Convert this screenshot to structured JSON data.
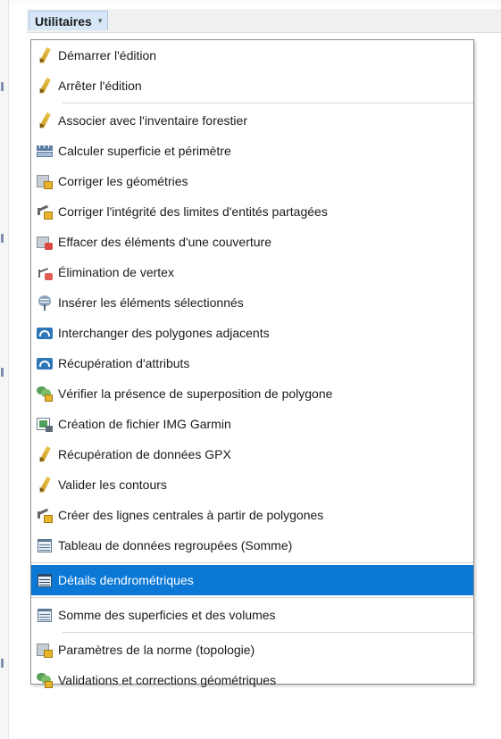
{
  "menu": {
    "title": "Utilitaires",
    "caret": "▾",
    "items": [
      {
        "label": "Démarrer l'édition",
        "icon": "pencil-icon"
      },
      {
        "label": "Arrêter l'édition",
        "icon": "pencil-icon"
      },
      {
        "label": "Associer avec l'inventaire forestier",
        "icon": "pencil-icon"
      },
      {
        "label": "Calculer superficie et périmètre",
        "icon": "ruler-icon"
      },
      {
        "label": "Corriger les géométries",
        "icon": "layer-edit-icon"
      },
      {
        "label": "Corriger l'intégrité des limites d'entités partagées",
        "icon": "line-edit-icon"
      },
      {
        "label": "Effacer des éléments d'une couverture",
        "icon": "erase-layer-icon"
      },
      {
        "label": "Élimination de vertex",
        "icon": "vertex-delete-icon"
      },
      {
        "label": "Insérer les éléments sélectionnés",
        "icon": "tree-icon"
      },
      {
        "label": "Interchanger des polygones adjacents",
        "icon": "swap-polygons-icon"
      },
      {
        "label": "Récupération d'attributs",
        "icon": "swap-polygons-icon"
      },
      {
        "label": "Vérifier la présence de superposition de polygone",
        "icon": "overlap-check-icon"
      },
      {
        "label": "Création de fichier IMG Garmin",
        "icon": "garmin-image-icon"
      },
      {
        "label": "Récupération de données GPX",
        "icon": "pencil-icon"
      },
      {
        "label": "Valider les contours",
        "icon": "pencil-icon"
      },
      {
        "label": "Créer des lignes centrales à partir de polygones",
        "icon": "line-edit-icon"
      },
      {
        "label": "Tableau de données regroupées (Somme)",
        "icon": "table-icon"
      },
      {
        "label": "Détails dendrométriques",
        "icon": "table-icon"
      },
      {
        "label": "Somme des superficies et des volumes",
        "icon": "table-icon"
      },
      {
        "label": "Paramètres de la norme (topologie)",
        "icon": "layer-edit-icon"
      },
      {
        "label": "Validations et corrections géométriques",
        "icon": "overlap-check-icon"
      }
    ],
    "highlighted_index": 17
  },
  "colors": {
    "highlight": "#0b78d6",
    "trigger_bg": "#d7e7f7"
  }
}
